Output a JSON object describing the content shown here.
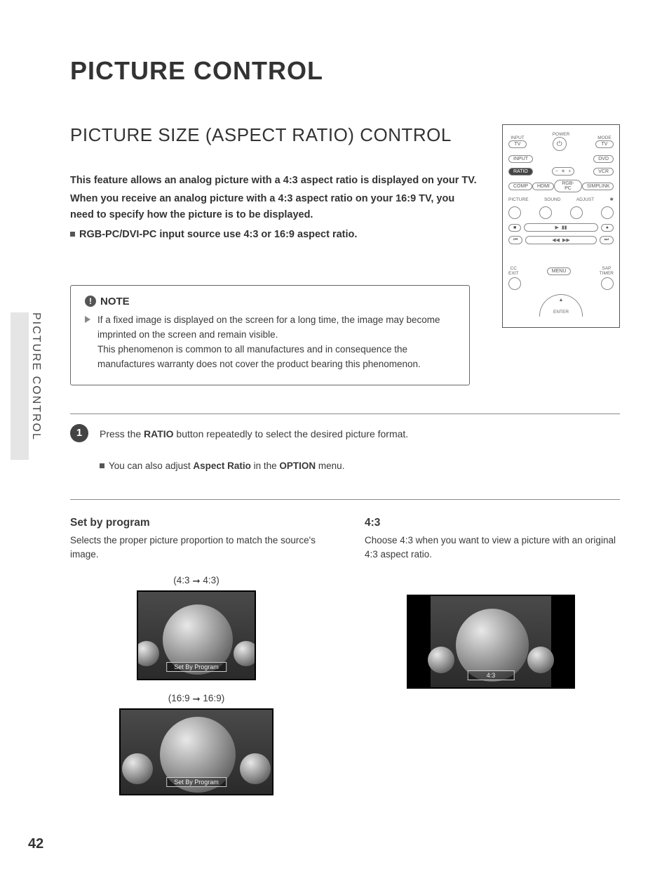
{
  "page_number": "42",
  "side_tab_label": "PICTURE CONTROL",
  "title": "PICTURE CONTROL",
  "subtitle": "PICTURE SIZE (ASPECT RATIO) CONTROL",
  "intro": {
    "line1": "This feature allows an analog picture with a 4:3 aspect ratio is displayed on your TV.",
    "line2": "When you receive an analog picture with a 4:3 aspect ratio on your 16:9 TV, you need to specify how the picture is to be displayed.",
    "bullet": "RGB-PC/DVI-PC input source use 4:3 or 16:9 aspect ratio."
  },
  "note": {
    "heading": "NOTE",
    "body": "If a fixed image is displayed on the screen for a long time, the image may become imprinted on the screen and remain visible.\nThis phenomenon is common to all manufactures and in consequence the manufactures warranty does not cover the product bearing this phenomenon."
  },
  "step": {
    "num": "1",
    "text_pre": "Press the ",
    "text_bold1": "RATIO",
    "text_post": " button repeatedly to select the desired picture format.",
    "sub_pre": "You can also adjust ",
    "sub_bold1": "Aspect Ratio",
    "sub_mid": " in the ",
    "sub_bold2": "OPTION",
    "sub_post": " menu."
  },
  "modes": {
    "set_by_program": {
      "title": "Set by program",
      "desc": "Selects the proper picture proportion to match the source's image.",
      "conv1_from": "4:3",
      "conv1_to": "4:3",
      "conv2_from": "16:9",
      "conv2_to": "16:9",
      "osd": "Set By Program"
    },
    "four_three": {
      "title": "4:3",
      "desc": "Choose 4:3 when you want to view a picture with an original 4:3 aspect ratio.",
      "osd": "4:3"
    }
  },
  "remote": {
    "input": "INPUT",
    "mode": "MODE",
    "tv": "TV",
    "power": "POWER",
    "dvd": "DVD",
    "input_btn": "INPUT",
    "ratio": "RATIO",
    "vcr": "VCR",
    "comp": "COMP",
    "hdmi": "HDMI",
    "rgbpc": "RGB-PC",
    "simplink": "SIMPLINK",
    "picture": "PICTURE",
    "sound": "SOUND",
    "adjust": "ADJUST",
    "star": "✱",
    "cc": "CC",
    "menu": "MENU",
    "sap": "SAP",
    "exit": "EXIT",
    "timer": "TIMER",
    "enter": "ENTER"
  }
}
